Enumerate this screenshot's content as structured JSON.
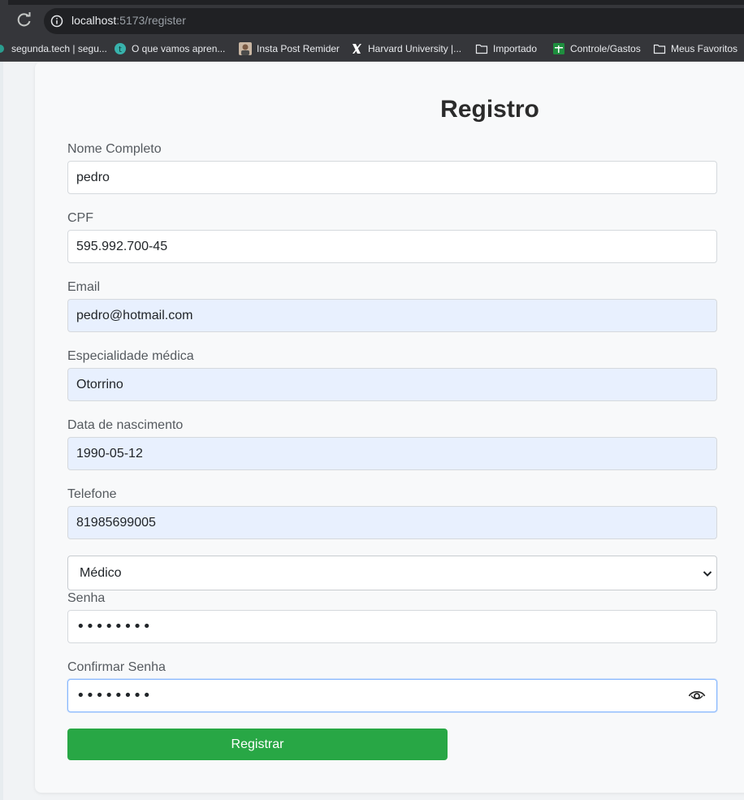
{
  "browser": {
    "url_host": "localhost",
    "url_path": ":5173/register"
  },
  "bookmarks": [
    {
      "label": "segunda.tech | segu...",
      "icon": "site-dot-icon"
    },
    {
      "label": "O que vamos apren...",
      "icon": "circle-t-icon"
    },
    {
      "label": "Insta Post Remider",
      "icon": "avatar-icon"
    },
    {
      "label": "Harvard University |...",
      "icon": "x-logo-icon"
    },
    {
      "label": "Importado",
      "icon": "folder-icon"
    },
    {
      "label": "Controle/Gastos",
      "icon": "sheets-icon"
    },
    {
      "label": "Meus Favoritos",
      "icon": "folder-icon"
    }
  ],
  "form": {
    "title": "Registro",
    "name_label": "Nome Completo",
    "name_value": "pedro",
    "cpf_label": "CPF",
    "cpf_value": "595.992.700-45",
    "email_label": "Email",
    "email_value": "pedro@hotmail.com",
    "specialty_label": "Especialidade médica",
    "specialty_value": "Otorrino",
    "birth_label": "Data de nascimento",
    "birth_value": "1990-05-12",
    "phone_label": "Telefone",
    "phone_value": "81985699005",
    "role_value": "Médico",
    "password_label": "Senha",
    "password_value": "••••••••",
    "confirm_label": "Confirmar Senha",
    "confirm_value": "••••••••",
    "submit_label": "Registrar"
  },
  "colors": {
    "accent": "#28a745",
    "autofill": "#e8f0fe",
    "chrome": "#35363a"
  }
}
